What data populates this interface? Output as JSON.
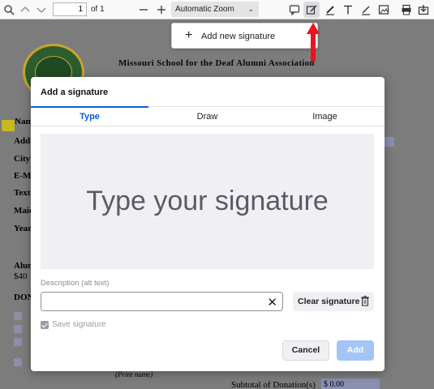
{
  "toolbar": {
    "page_number": "1",
    "page_of": "of 1",
    "zoom_label": "Automatic Zoom"
  },
  "signature_menu": {
    "add_new_label": "Add new signature"
  },
  "document": {
    "title": "Missouri School for the Deaf Alumni Association",
    "field_labels": [
      "Nam",
      "Add",
      "City",
      "E-M",
      "Text",
      "Maid",
      "Year"
    ],
    "alumni_label": "Alun",
    "price_label": "$40",
    "donation_label": "DON",
    "print_name": "(Print name)",
    "subtotal_label": "Subtotal of Donation(s)",
    "subtotal_value": "$ 0.00"
  },
  "modal": {
    "title": "Add a signature",
    "tabs": [
      "Type",
      "Draw",
      "Image"
    ],
    "active_tab": "Type",
    "placeholder": "Type your signature",
    "description_label": "Description (alt text)",
    "clear_label": "Clear signature",
    "save_label": "Save signature",
    "cancel_label": "Cancel",
    "add_label": "Add"
  },
  "colors": {
    "accent": "#0b5dd7",
    "add_disabled": "#a3c4f5",
    "arrow": "#e8141b"
  }
}
